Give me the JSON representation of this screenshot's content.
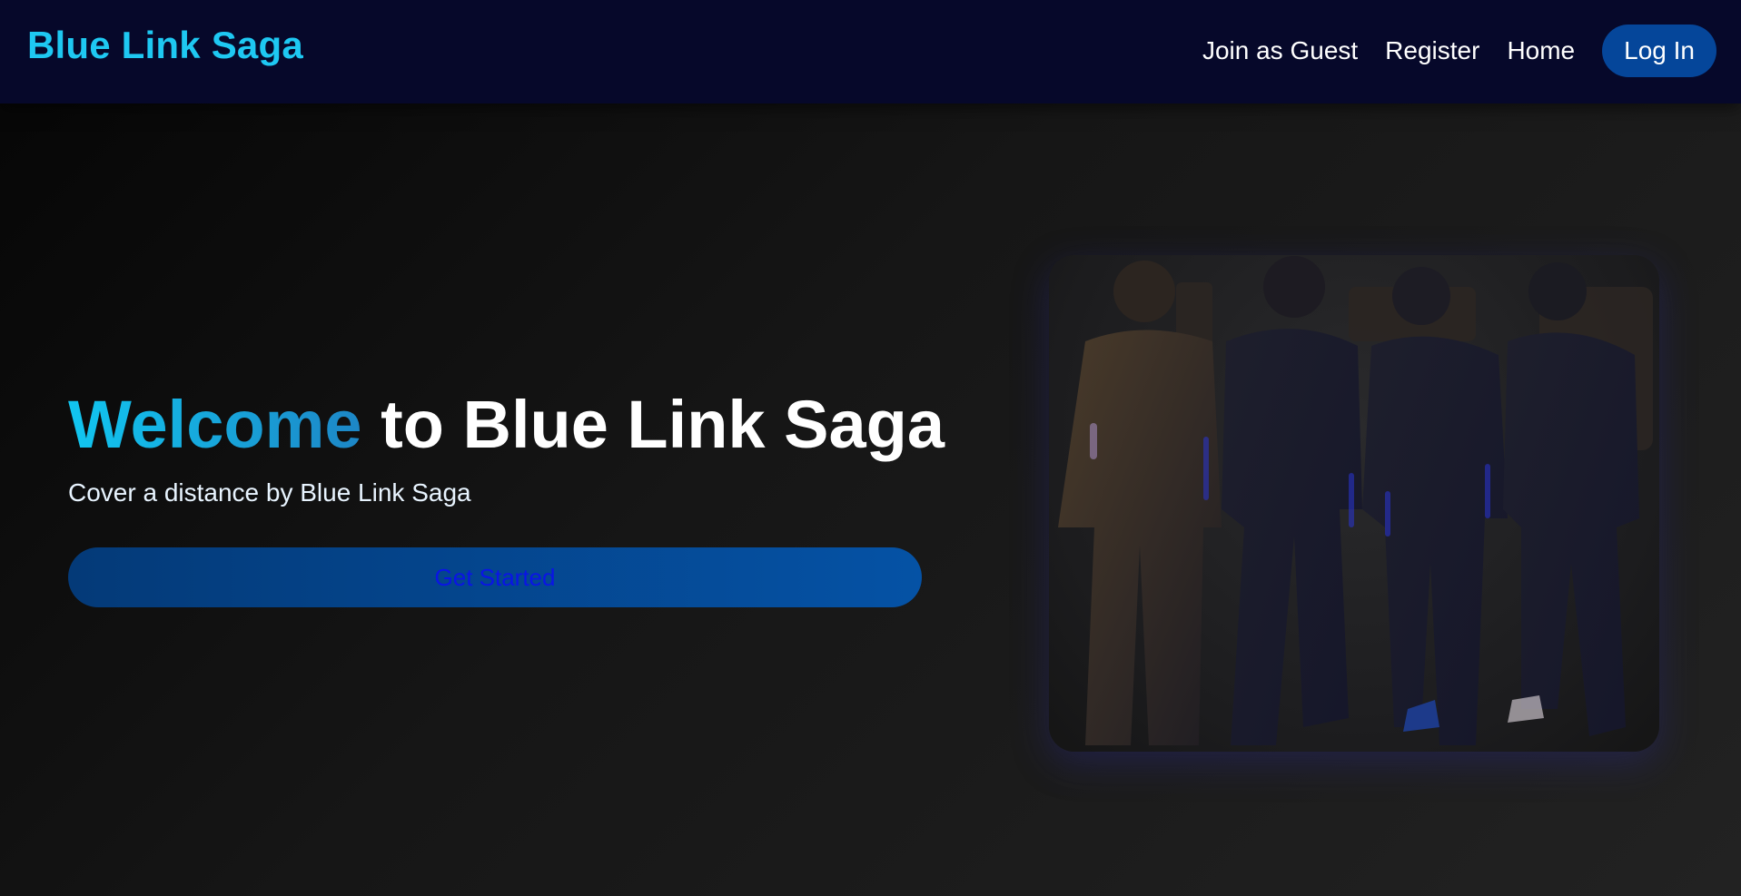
{
  "header": {
    "brand": "Blue Link Saga",
    "nav": {
      "join_guest": "Join as Guest",
      "register": "Register",
      "home": "Home",
      "login": "Log In"
    }
  },
  "hero": {
    "title_accent": "Welcome",
    "title_rest": " to Blue Link Saga",
    "subtitle": "Cover a distance by Blue Link Saga",
    "cta_label": "Get Started"
  },
  "colors": {
    "brand": "#1ec8f2",
    "navbar_bg": "#06082a",
    "login_bg": "#05469a",
    "cta_bg": "#0552a5",
    "cta_text": "#0a14e6"
  }
}
